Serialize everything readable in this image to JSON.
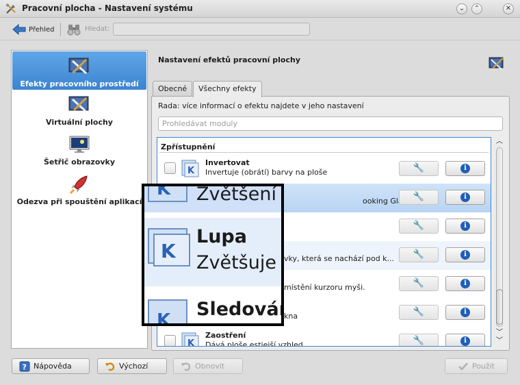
{
  "window": {
    "title": "Pracovní plocha - Nastavení systému"
  },
  "toolbar": {
    "back_label": "Přehled",
    "search_label": "Hledat:",
    "search_value": ""
  },
  "categories": [
    {
      "label": "Efekty pracovního prostředí",
      "icon": "desktop-effects-icon",
      "selected": true
    },
    {
      "label": "Virtuální plochy",
      "icon": "virtual-desktops-icon"
    },
    {
      "label": "Šetřič obrazovky",
      "icon": "screensaver-icon"
    },
    {
      "label": "Odezva při spouštění aplikací",
      "icon": "rocket-icon"
    }
  ],
  "header": {
    "title": "Nastavení efektů pracovní plochy"
  },
  "tabs": [
    {
      "label": "Obecné"
    },
    {
      "label": "Všechny efekty",
      "active": true
    }
  ],
  "hint": "Rada: více informací o efektu najdete v jeho nastavení",
  "filter": {
    "placeholder": "Prohledávat moduly"
  },
  "effects": {
    "group": "Zpřístupnění",
    "rows": [
      {
        "name": "Invertovat",
        "desc": "Invertuje (obrátí) barvy na ploše"
      },
      {
        "name": "",
        "desc": "ooking Glass",
        "selected": true
      },
      {
        "name": "",
        "desc": ""
      },
      {
        "name": "",
        "desc": "vky, která se nachází pod k..."
      },
      {
        "name": "",
        "desc": "místění kurzoru myši."
      },
      {
        "name": "",
        "desc": "kna"
      },
      {
        "name": "Zaostření",
        "desc": "Dává ploše estiejší vzhled"
      }
    ]
  },
  "zoom": {
    "line1": "Zvětšení o",
    "line2": "Lupa",
    "line3": "Zvětšuje o",
    "line4": "Sledován"
  },
  "buttons": {
    "help": "Nápověda",
    "default": "Výchozí",
    "reset": "Obnovit",
    "apply": "Použít"
  },
  "colors": {
    "selection": "#3c84d0",
    "info_icon": "#1f5fb8"
  }
}
